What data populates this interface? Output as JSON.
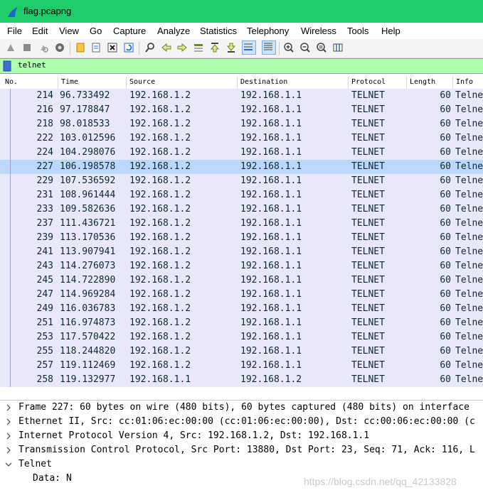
{
  "window": {
    "title": "flag.pcapng"
  },
  "menu": [
    "File",
    "Edit",
    "View",
    "Go",
    "Capture",
    "Analyze",
    "Statistics",
    "Telephony",
    "Wireless",
    "Tools",
    "Help"
  ],
  "filter": {
    "value": "telnet"
  },
  "columns": {
    "no": "No.",
    "time": "Time",
    "source": "Source",
    "destination": "Destination",
    "protocol": "Protocol",
    "length": "Length",
    "info": "Info"
  },
  "packets": [
    {
      "no": "214",
      "time": "96.733492",
      "src": "192.168.1.2",
      "dst": "192.168.1.1",
      "proto": "TELNET",
      "len": "60",
      "info": "Telne"
    },
    {
      "no": "216",
      "time": "97.178847",
      "src": "192.168.1.2",
      "dst": "192.168.1.1",
      "proto": "TELNET",
      "len": "60",
      "info": "Telne"
    },
    {
      "no": "218",
      "time": "98.018533",
      "src": "192.168.1.2",
      "dst": "192.168.1.1",
      "proto": "TELNET",
      "len": "60",
      "info": "Telne"
    },
    {
      "no": "222",
      "time": "103.012596",
      "src": "192.168.1.2",
      "dst": "192.168.1.1",
      "proto": "TELNET",
      "len": "60",
      "info": "Telne"
    },
    {
      "no": "224",
      "time": "104.298076",
      "src": "192.168.1.2",
      "dst": "192.168.1.1",
      "proto": "TELNET",
      "len": "60",
      "info": "Telne"
    },
    {
      "no": "227",
      "time": "106.198578",
      "src": "192.168.1.2",
      "dst": "192.168.1.1",
      "proto": "TELNET",
      "len": "60",
      "info": "Telne",
      "selected": true
    },
    {
      "no": "229",
      "time": "107.536592",
      "src": "192.168.1.2",
      "dst": "192.168.1.1",
      "proto": "TELNET",
      "len": "60",
      "info": "Telne"
    },
    {
      "no": "231",
      "time": "108.961444",
      "src": "192.168.1.2",
      "dst": "192.168.1.1",
      "proto": "TELNET",
      "len": "60",
      "info": "Telne"
    },
    {
      "no": "233",
      "time": "109.582636",
      "src": "192.168.1.2",
      "dst": "192.168.1.1",
      "proto": "TELNET",
      "len": "60",
      "info": "Telne"
    },
    {
      "no": "237",
      "time": "111.436721",
      "src": "192.168.1.2",
      "dst": "192.168.1.1",
      "proto": "TELNET",
      "len": "60",
      "info": "Telne"
    },
    {
      "no": "239",
      "time": "113.170536",
      "src": "192.168.1.2",
      "dst": "192.168.1.1",
      "proto": "TELNET",
      "len": "60",
      "info": "Telne"
    },
    {
      "no": "241",
      "time": "113.907941",
      "src": "192.168.1.2",
      "dst": "192.168.1.1",
      "proto": "TELNET",
      "len": "60",
      "info": "Telne"
    },
    {
      "no": "243",
      "time": "114.276073",
      "src": "192.168.1.2",
      "dst": "192.168.1.1",
      "proto": "TELNET",
      "len": "60",
      "info": "Telne"
    },
    {
      "no": "245",
      "time": "114.722890",
      "src": "192.168.1.2",
      "dst": "192.168.1.1",
      "proto": "TELNET",
      "len": "60",
      "info": "Telne"
    },
    {
      "no": "247",
      "time": "114.969284",
      "src": "192.168.1.2",
      "dst": "192.168.1.1",
      "proto": "TELNET",
      "len": "60",
      "info": "Telne"
    },
    {
      "no": "249",
      "time": "116.036783",
      "src": "192.168.1.2",
      "dst": "192.168.1.1",
      "proto": "TELNET",
      "len": "60",
      "info": "Telne"
    },
    {
      "no": "251",
      "time": "116.974873",
      "src": "192.168.1.2",
      "dst": "192.168.1.1",
      "proto": "TELNET",
      "len": "60",
      "info": "Telne"
    },
    {
      "no": "253",
      "time": "117.570422",
      "src": "192.168.1.2",
      "dst": "192.168.1.1",
      "proto": "TELNET",
      "len": "60",
      "info": "Telne"
    },
    {
      "no": "255",
      "time": "118.244820",
      "src": "192.168.1.2",
      "dst": "192.168.1.1",
      "proto": "TELNET",
      "len": "60",
      "info": "Telne"
    },
    {
      "no": "257",
      "time": "119.112469",
      "src": "192.168.1.2",
      "dst": "192.168.1.1",
      "proto": "TELNET",
      "len": "60",
      "info": "Telne"
    },
    {
      "no": "258",
      "time": "119.132977",
      "src": "192.168.1.1",
      "dst": "192.168.1.2",
      "proto": "TELNET",
      "len": "60",
      "info": "Telne"
    }
  ],
  "details": [
    {
      "text": "Frame 227: 60 bytes on wire (480 bits), 60 bytes captured (480 bits) on interface",
      "expanded": false
    },
    {
      "text": "Ethernet II, Src: cc:01:06:ec:00:00 (cc:01:06:ec:00:00), Dst: cc:00:06:ec:00:00 (c",
      "expanded": false
    },
    {
      "text": "Internet Protocol Version 4, Src: 192.168.1.2, Dst: 192.168.1.1",
      "expanded": false
    },
    {
      "text": "Transmission Control Protocol, Src Port: 13880, Dst Port: 23, Seq: 71, Ack: 116, L",
      "expanded": false
    },
    {
      "text": "Telnet",
      "expanded": true
    },
    {
      "text": "Data: N",
      "child": true
    }
  ],
  "watermark": "https://blog.csdn.net/qq_42133828",
  "colors": {
    "titlebar": "#1ecd6a",
    "filter_bg": "#afffaf",
    "row_bg": "#e8e8fa",
    "row_selected": "#bbd7fb"
  }
}
